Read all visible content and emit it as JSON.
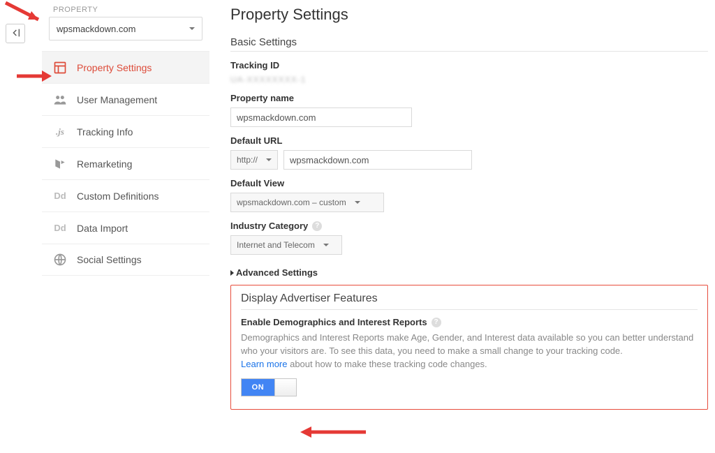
{
  "sidebar": {
    "group_label": "PROPERTY",
    "selected_property": "wpsmackdown.com",
    "items": [
      {
        "label": "Property Settings"
      },
      {
        "label": "User Management"
      },
      {
        "label": "Tracking Info"
      },
      {
        "label": "Remarketing"
      },
      {
        "label": "Custom Definitions"
      },
      {
        "label": "Data Import"
      },
      {
        "label": "Social Settings"
      }
    ]
  },
  "page": {
    "title": "Property Settings",
    "basic_heading": "Basic Settings",
    "tracking_id_label": "Tracking ID",
    "tracking_id_value": "UA-XXXXXXXX-1",
    "property_name_label": "Property name",
    "property_name_value": "wpsmackdown.com",
    "default_url_label": "Default URL",
    "default_url_scheme": "http://",
    "default_url_value": "wpsmackdown.com",
    "default_view_label": "Default View",
    "default_view_value": "wpsmackdown.com – custom",
    "industry_label": "Industry Category",
    "industry_value": "Internet and Telecom",
    "advanced_heading": "Advanced Settings",
    "daf_heading": "Display Advertiser Features",
    "enable_demo_heading": "Enable Demographics and Interest Reports",
    "daf_desc_1": "Demographics and Interest Reports make Age, Gender, and Interest data available so you can better understand who your visitors are. To see this data, you need to make a small change to your tracking code.",
    "learn_more": "Learn more",
    "daf_desc_2": " about how to make these tracking code changes.",
    "toggle_label": "ON"
  }
}
